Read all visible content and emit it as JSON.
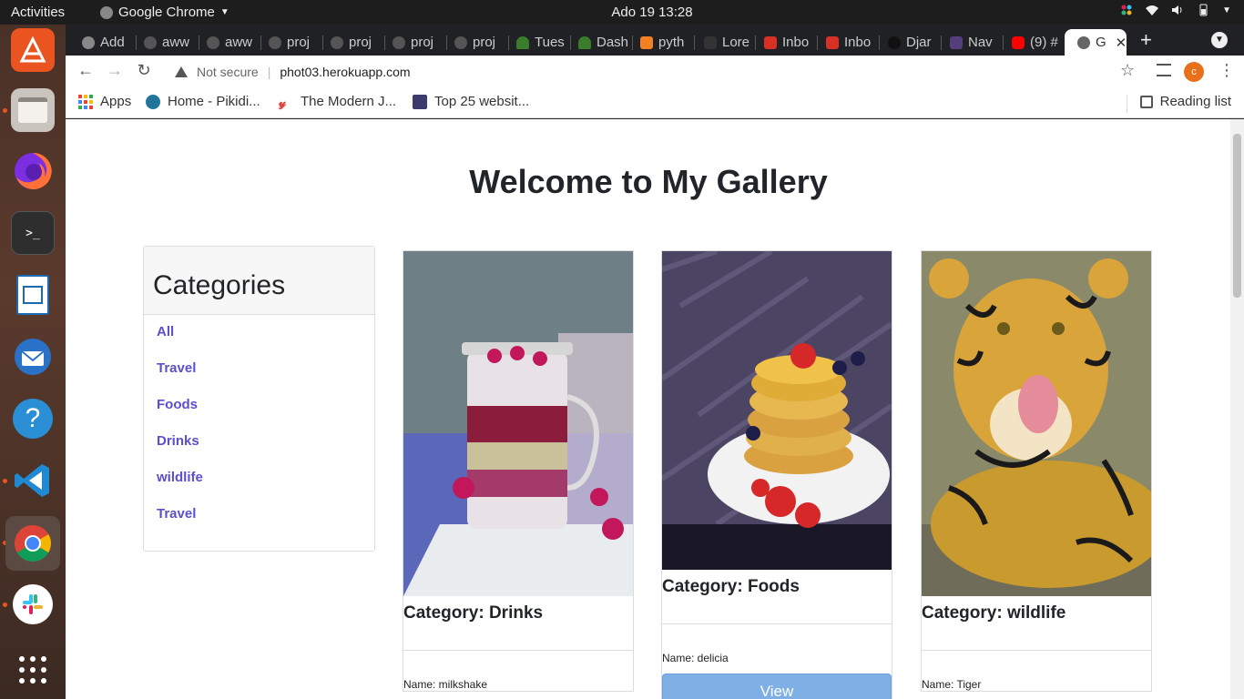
{
  "topbar": {
    "activities": "Activities",
    "app_name": "Google Chrome",
    "clock": "Ado 19  13:28"
  },
  "dock": {
    "apps": [
      "ubuntu-software",
      "files",
      "firefox",
      "terminal",
      "libreoffice-writer",
      "thunderbird",
      "help",
      "vscode",
      "chrome",
      "slack",
      "show-apps"
    ]
  },
  "tabs": [
    {
      "label": "Add",
      "icon": "globe-icon",
      "color": "#888"
    },
    {
      "label": "aww",
      "icon": "github-icon",
      "color": "#555"
    },
    {
      "label": "aww",
      "icon": "github-icon",
      "color": "#555"
    },
    {
      "label": "proj",
      "icon": "github-icon",
      "color": "#555"
    },
    {
      "label": "proj",
      "icon": "github-icon",
      "color": "#555"
    },
    {
      "label": "proj",
      "icon": "github-icon",
      "color": "#555"
    },
    {
      "label": "proj",
      "icon": "github-icon",
      "color": "#555"
    },
    {
      "label": "Tues",
      "icon": "tree-icon",
      "color": "#3a7d2c"
    },
    {
      "label": "Dash",
      "icon": "tree-icon",
      "color": "#3a7d2c"
    },
    {
      "label": "pyth",
      "icon": "stackoverflow-icon",
      "color": "#f48024"
    },
    {
      "label": "Lore",
      "icon": "doc-icon",
      "color": "#333"
    },
    {
      "label": "Inbo",
      "icon": "gmail-icon",
      "color": "#d93025"
    },
    {
      "label": "Inbo",
      "icon": "gmail-icon",
      "color": "#d93025"
    },
    {
      "label": "Djar",
      "icon": "medium-icon",
      "color": "#111"
    },
    {
      "label": "Nav",
      "icon": "bootstrap-icon",
      "color": "#563d7c"
    },
    {
      "label": "(9) #",
      "icon": "youtube-icon",
      "color": "#ff0000"
    },
    {
      "label": "G",
      "icon": "globe-icon",
      "color": "#666",
      "active": true
    }
  ],
  "toolbar": {
    "security": "Not secure",
    "url": "phot03.herokuapp.com",
    "profile_initial": "c"
  },
  "bookmarks": {
    "items": [
      "Apps",
      "Home - Pikidi...",
      "The Modern J...",
      "Top 25 websit..."
    ],
    "reading_list": "Reading list"
  },
  "page": {
    "title": "Welcome to My Gallery",
    "categories_heading": "Categories",
    "categories": [
      "All",
      "Travel",
      "Foods",
      "Drinks",
      "wildlife",
      "Travel"
    ],
    "cards": [
      {
        "category": "Category: Drinks",
        "name": "Name: milkshake",
        "image": "milkshake-jar-photo"
      },
      {
        "category": "Category: Foods",
        "name": "Name: delicia",
        "image": "pancakes-photo",
        "button": "View"
      },
      {
        "category": "Category: wildlife",
        "name": "Name: Tiger",
        "image": "tiger-photo"
      }
    ]
  }
}
